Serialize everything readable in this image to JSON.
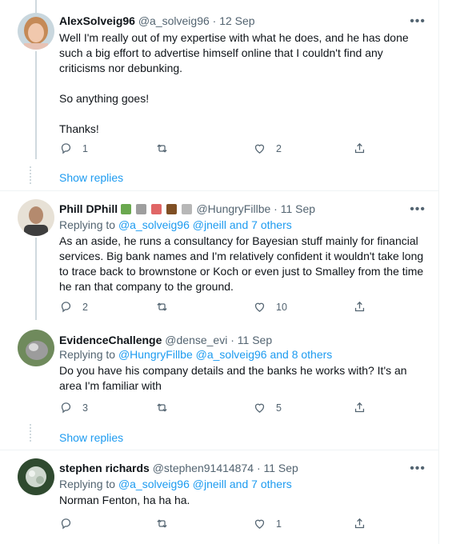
{
  "tweets": [
    {
      "name": "AlexSolveig96",
      "handle": "@a_solveig96",
      "date": "· 12 Sep",
      "body": [
        "Well I'm really out of my expertise with what he does, and he has done such a big effort to advertise himself online that I couldn't find any criticisms nor debunking.",
        "So anything goes!",
        "Thanks!"
      ],
      "replies": "1",
      "retweets": "",
      "likes": "2"
    },
    {
      "name": "Phill DPhill",
      "handle": "@HungryFillbe",
      "date": "· 11 Sep",
      "replying_prefix": "Replying to",
      "replying_mentions": "@a_solveig96 @jneill",
      "replying_others": "and 7 others",
      "body": [
        "As an aside, he runs a consultancy for Bayesian stuff mainly for financial services. Big bank names and I'm relatively confident it wouldn't take long to trace back to brownstone or Koch or even just to Smalley from the time he ran that company to the ground."
      ],
      "replies": "2",
      "retweets": "",
      "likes": "10"
    },
    {
      "name": "EvidenceChallenge",
      "handle": "@dense_evi",
      "date": "· 11 Sep",
      "replying_prefix": "Replying to",
      "replying_mentions": "@HungryFillbe @a_solveig96",
      "replying_others": "and 8 others",
      "body": [
        "Do you have his company details and the banks he works with? It's an area I'm familiar with"
      ],
      "replies": "3",
      "retweets": "",
      "likes": "5"
    },
    {
      "name": "stephen richards",
      "handle": "@stephen91414874",
      "date": "· 11 Sep",
      "replying_prefix": "Replying to",
      "replying_mentions": "@a_solveig96 @jneill",
      "replying_others": "and 7 others",
      "body": [
        "Norman Fenton, ha ha ha."
      ],
      "replies": "",
      "retweets": "",
      "likes": "1"
    }
  ],
  "show_replies_label": "Show replies",
  "more_glyph": "•••",
  "colors": {
    "link": "#1d9bf0",
    "muted": "#536471",
    "text": "#0f1419",
    "border": "#eff3f4",
    "thread": "#cfd9de"
  },
  "icons": [
    "reply-icon",
    "retweet-icon",
    "like-icon",
    "share-icon",
    "more-icon"
  ]
}
